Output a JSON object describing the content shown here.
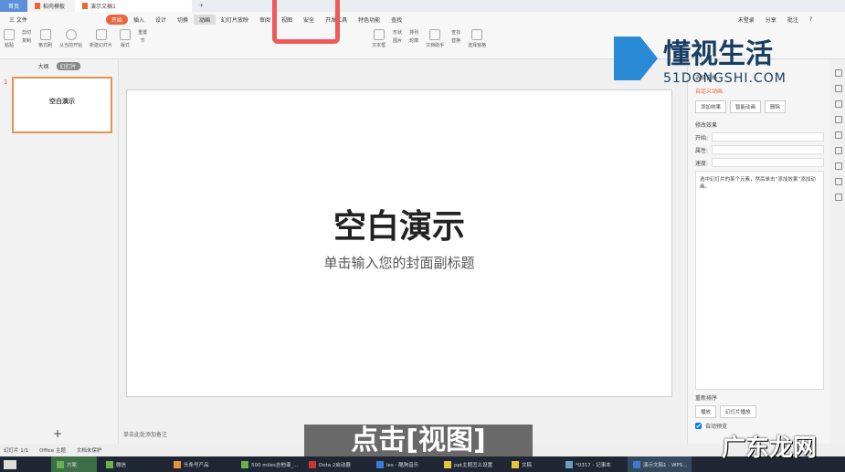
{
  "tabs": [
    {
      "label": "首页"
    },
    {
      "label": "稻壳模板"
    },
    {
      "label": "演示文稿1"
    }
  ],
  "menu": {
    "file": "三 文件",
    "items": [
      "开始",
      "插入",
      "设计",
      "切换",
      "动画",
      "幻灯片放映",
      "审阅",
      "视图",
      "安全",
      "开发工具",
      "特色功能",
      "查找"
    ],
    "right": [
      "未登录",
      "分享",
      "批注",
      "?"
    ]
  },
  "ribbon": [
    "粘贴",
    "剪切",
    "复制",
    "格式刷",
    "从当前开始",
    "新建幻灯片",
    "版式",
    "重置",
    "节",
    "文本框",
    "形状",
    "图片",
    "排列",
    "轮廓",
    "文档助手",
    "查找",
    "替换",
    "选择窗格"
  ],
  "left": {
    "outline": "大纲",
    "slides": "幻灯片",
    "thumb_title": "空白演示",
    "slide_num": "1",
    "add": "+"
  },
  "slide": {
    "title": "空白演示",
    "subtitle": "单击输入您的封面副标题"
  },
  "notes": "单击此处添加备注",
  "rightpane": {
    "select_pane": "选择窗格",
    "heading": "自定义动画",
    "add": "添加效果",
    "smart": "智能动画",
    "delete": "删除",
    "modify": "修改效果",
    "start": "开始:",
    "prop": "属性:",
    "speed": "速度:",
    "hint": "选中幻灯片的某个元素，然后单击“添加效果”添加动画。",
    "reorder": "重新排序",
    "play": "播放",
    "slideshow": "幻灯片播放",
    "autopreview": "自动预览"
  },
  "status": {
    "slide": "幻灯片 1/1",
    "theme": "Office 主题",
    "protect": "文档未保护"
  },
  "taskbar": [
    "方案",
    "微信",
    "头条号产品",
    "500 miles吉他谱_...",
    "Dota 2启动器",
    "les - 酷狗音乐",
    "ppt主题怎么设置",
    "文稿",
    "*0317 - 记事本",
    "演示文稿1 - WPS..."
  ],
  "caption": "点击[视图]",
  "watermarks": {
    "brand": "懂视生活",
    "url": "51DONGSHI.COM",
    "corner": "广东龙网"
  }
}
